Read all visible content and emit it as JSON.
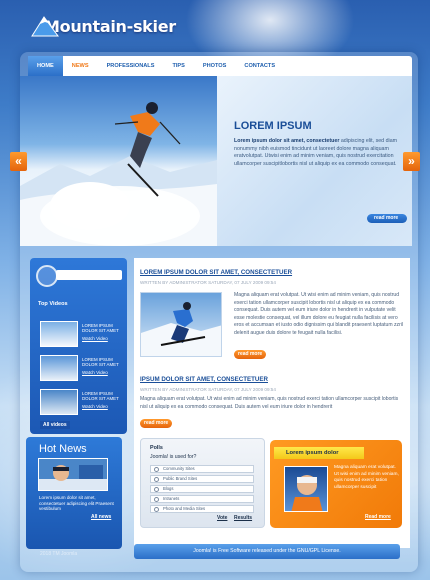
{
  "brand": {
    "name": "Mountain-skier"
  },
  "nav": {
    "items": [
      "HOME",
      "NEWS",
      "PROFESSIONALS",
      "TIPS",
      "PHOTOS",
      "CONTACTS"
    ]
  },
  "hero": {
    "title": "LOREM IPSUM",
    "bold_lead": "Lorem ipsum dolor sit amet, consectetuer",
    "body": " adipiscing elit, sed diam nonummy nibh euismod tincidunt ut laoreet dolore magna aliquam eratvolutpat. Utwisi enim ad minim veniam, quis nostrud exercitation ullamcorper suscipitlobortis nisl ut aliquip ex ea commodo consequat.",
    "read_more": "read more",
    "prev_arrow": "«",
    "next_arrow": "»"
  },
  "sidebar": {
    "top_videos_title": "Top Videos",
    "videos": [
      {
        "text": "LOREM IPSUM DOLOR SIT AMET",
        "link": "Watch Video"
      },
      {
        "text": "LOREM IPSUM DOLOR SIT AMET",
        "link": "Watch Video"
      },
      {
        "text": "LOREM IPSUM DOLOR SIT AMET",
        "link": "Watch Video"
      }
    ],
    "all_videos": "All videos"
  },
  "hot_news": {
    "title": "Hot News",
    "body": "Lorem ipsum dolor sit amet, consectetuer adipiscing elit Praesent vestibulum",
    "all_news": "All news"
  },
  "articles": [
    {
      "title": "LOREM IPSUM DOLOR SIT AMET, CONSECTETUER",
      "meta": "WRITTEN BY ADMINISTRATOR SATURDAY, 07 JULY 2009 09:54",
      "body": "Magna aliquam erat volutpat. Ut wisi enim ad minim veniam, quis nostrud exerci tation ullamcorper suscipit lobortis nisl ut aliquip ex ea commodo consequat. Duis autem vel eum iriure dolor in hendrerit in vulputate velit esse molestie consequat, vel illum dolore eu feugiat nulla facilisis at vero eros et accumsan et iusto odio dignissim qui blandit praesent luptatum zzril delenit augue duis dolore te feugait nulla facilisi.",
      "read_more": "read more"
    },
    {
      "title": "IPSUM DOLOR SIT AMET, CONSECTETUER",
      "meta": "WRITTEN BY ADMINISTRATOR SATURDAY, 07 JULY 2009 09:54",
      "body": "Magna aliquam erat volutpat. Ut wisi enim ad minim veniam, quis nostrud exerci tation ullamcorper suscipit lobortis nisl ut aliquip ex ea commodo consequat. Duis autem vel eum iriure dolor in hendrerit",
      "read_more": "read more"
    }
  ],
  "polls": {
    "title": "Polls",
    "question": "Joomla! is used for?",
    "options": [
      "Community Sites",
      "Public Brand Sites",
      "Blogs",
      "Intranets",
      "Photo and Media Sites"
    ],
    "vote": "Vote",
    "results": "Results"
  },
  "promo": {
    "title": "Lorem ipsum dolor",
    "body": "Magna aliquam erat volutpat. Ut wisi enim ad minim veniam, quis nostrud exerci tation ullamcorper suscipit",
    "read_more": "Read more"
  },
  "footer": {
    "copyright": "2018 TM Joomla",
    "license": "Joomla! is Free Software released under the GNU/GPL License."
  },
  "colors": {
    "accent_blue": "#2b6fc8",
    "accent_orange": "#f17a08",
    "title_blue": "#1a4e98"
  }
}
